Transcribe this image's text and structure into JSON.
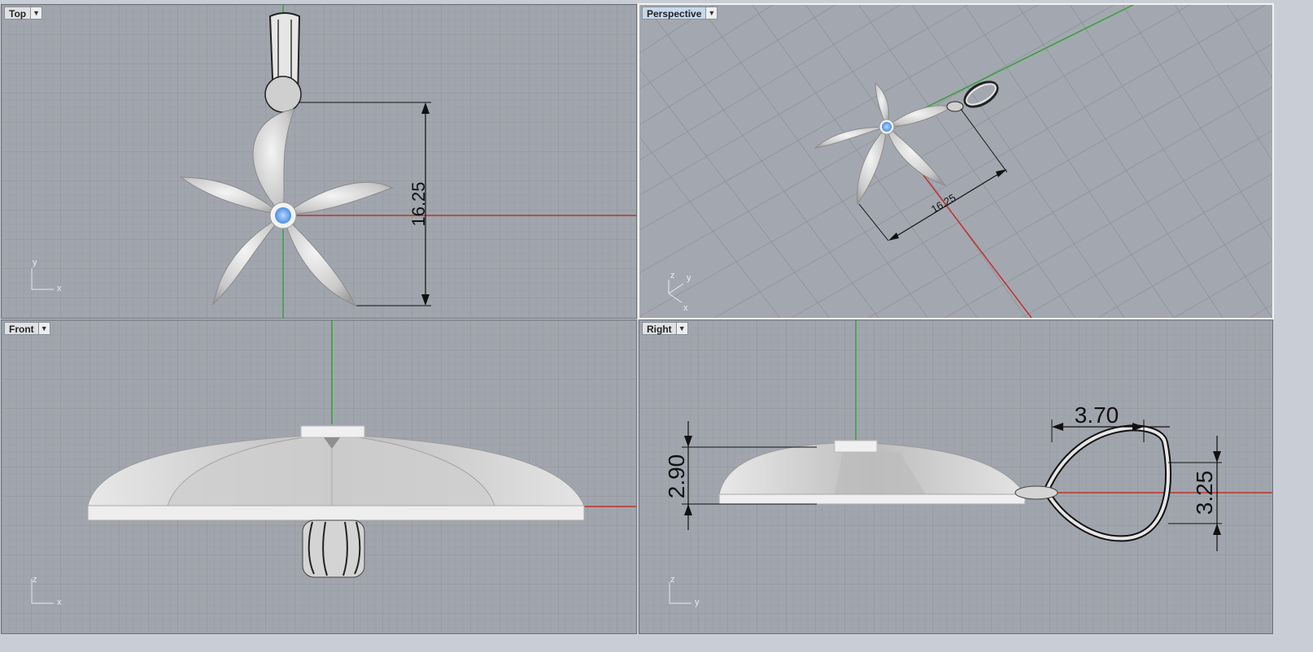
{
  "viewports": {
    "top": {
      "name": "Top",
      "dimension": "16.25",
      "axis1": "y",
      "axis2": "x"
    },
    "persp": {
      "name": "Perspective",
      "dimension": "16.25",
      "axis1": "z",
      "axis2": "y",
      "axis3": "x"
    },
    "front": {
      "name": "Front",
      "axis1": "z",
      "axis2": "x"
    },
    "right": {
      "name": "Right",
      "dim_width": "3.70",
      "dim_height_left": "2.90",
      "dim_height_right": "3.25",
      "axis1": "z",
      "axis2": "y"
    }
  },
  "icons": {
    "dropdown": "chevron-down-icon"
  },
  "colors": {
    "viewport_bg": "#a1a6ae",
    "grid": "#8d9299",
    "x_axis": "#c0302c",
    "y_axis": "#34a23a",
    "model": "#d8d8d8",
    "gem": "#6fa7ee"
  }
}
